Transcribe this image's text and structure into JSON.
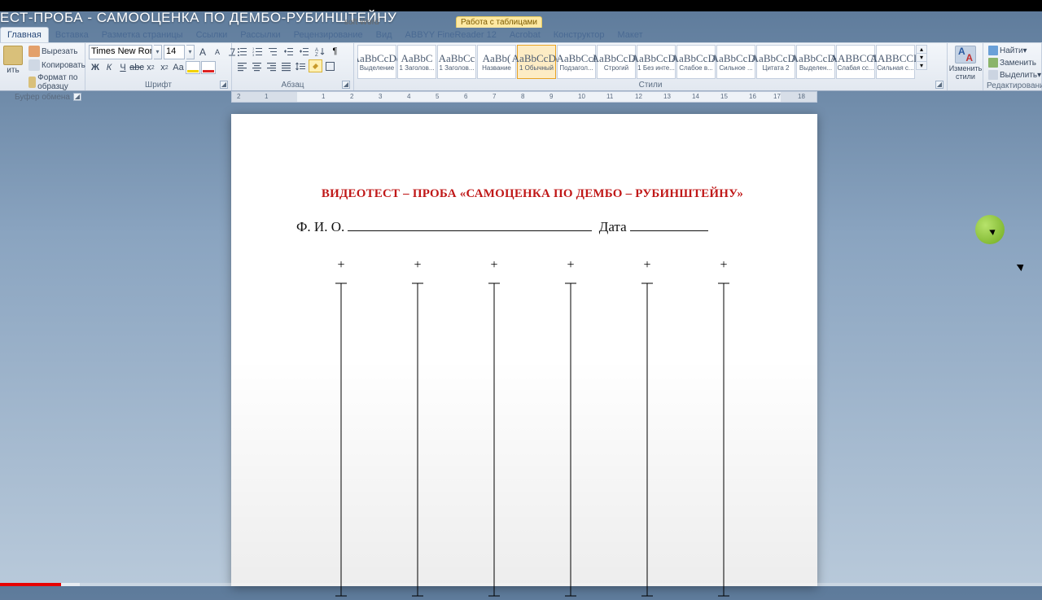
{
  "window_title": "ЕСТ-ПРОБА - САМООЦЕНКА ПО ДЕМБО-РУБИНШТЕЙНУ",
  "app_hint": "soft Word",
  "table_tools": "Работа с таблицами",
  "tabs": [
    "Главная",
    "Вставка",
    "Разметка страницы",
    "Ссылки",
    "Рассылки",
    "Рецензирование",
    "Вид",
    "ABBYY FineReader 12",
    "Acrobat",
    "Конструктор",
    "Макет"
  ],
  "clipboard": {
    "paste": "ить",
    "cut": "Вырезать",
    "copy": "Копировать",
    "format_painter": "Формат по образцу",
    "title": "Буфер обмена"
  },
  "font": {
    "name": "Times New Roman",
    "size": "14",
    "title": "Шрифт"
  },
  "paragraph": {
    "title": "Абзац"
  },
  "styles": {
    "title": "Стили",
    "items": [
      {
        "prev": "AaBbCcDd",
        "label": "Выделение",
        "cls": ""
      },
      {
        "prev": "AaBbC",
        "label": "1 Заголов...",
        "cls": ""
      },
      {
        "prev": "AaBbCc",
        "label": "1 Заголов...",
        "cls": ""
      },
      {
        "prev": "AaBb(",
        "label": "Название",
        "cls": ""
      },
      {
        "prev": "AaBbCcDd",
        "label": "1 Обычный",
        "cls": "sel"
      },
      {
        "prev": "AaBbCcI",
        "label": "Подзагол...",
        "cls": ""
      },
      {
        "prev": "AaBbCcDd",
        "label": "Строгий",
        "cls": ""
      },
      {
        "prev": "AaBbCcDd",
        "label": "1 Без инте...",
        "cls": ""
      },
      {
        "prev": "AaBbCcDd",
        "label": "Слабое в...",
        "cls": ""
      },
      {
        "prev": "AaBbCcDd",
        "label": "Сильное ...",
        "cls": ""
      },
      {
        "prev": "AaBbCcDd",
        "label": "Цитата 2",
        "cls": ""
      },
      {
        "prev": "AaBbCcDd",
        "label": "Выделен...",
        "cls": ""
      },
      {
        "prev": "AABBCCD",
        "label": "Слабая сс...",
        "cls": ""
      },
      {
        "prev": "AABBCCD",
        "label": "Сильная с...",
        "cls": ""
      }
    ],
    "change": "Изменить стили"
  },
  "editing": {
    "find": "Найти",
    "replace": "Заменить",
    "select": "Выделить",
    "title": "Редактирование"
  },
  "ruler_numbers": [
    "2",
    "1",
    "1",
    "2",
    "3",
    "4",
    "5",
    "6",
    "7",
    "8",
    "9",
    "10",
    "11",
    "12",
    "13",
    "14",
    "15",
    "16",
    "17",
    "18"
  ],
  "doc": {
    "title": "ВИДЕОТЕСТ – ПРОБА «САМОЦЕНКА ПО ДЕМБО – РУБИНШТЕЙНУ»",
    "fio": "Ф. И. О.",
    "date": "Дата",
    "scales": 6
  }
}
